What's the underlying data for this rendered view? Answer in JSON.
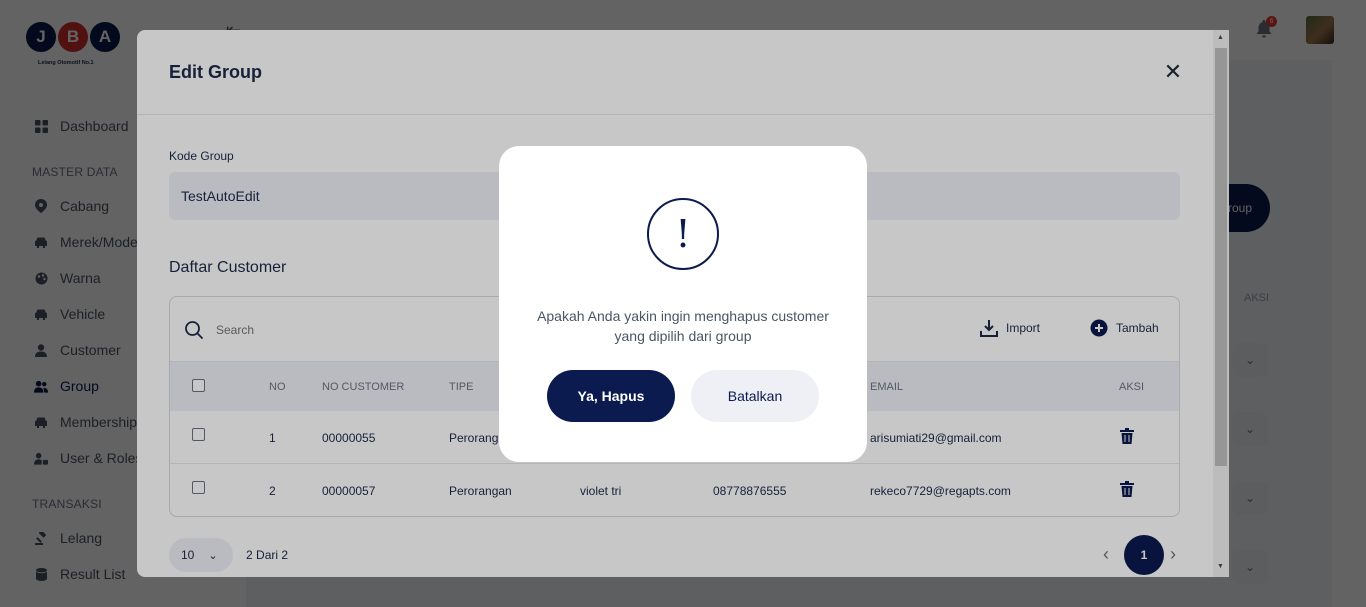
{
  "logo": {
    "letters": [
      "J",
      "B",
      "A"
    ],
    "colors": [
      "#0b1a4f",
      "#d32f2f",
      "#0b1a4f"
    ],
    "tagline": "Lelang Otomotif No.1"
  },
  "sidebar": {
    "items_top": [
      {
        "label": "Dashboard",
        "icon": "grid-icon"
      }
    ],
    "section_master": "MASTER DATA",
    "items_master": [
      {
        "label": "Cabang",
        "icon": "location-pin-icon"
      },
      {
        "label": "Merek/Model",
        "icon": "car-icon"
      },
      {
        "label": "Warna",
        "icon": "palette-icon"
      },
      {
        "label": "Vehicle",
        "icon": "car-icon"
      },
      {
        "label": "Customer",
        "icon": "user-icon"
      },
      {
        "label": "Group",
        "icon": "users-icon"
      },
      {
        "label": "Membership",
        "icon": "car-icon"
      },
      {
        "label": "User & Roles",
        "icon": "user-lock-icon"
      }
    ],
    "section_transaksi": "TRANSAKSI",
    "items_transaksi": [
      {
        "label": "Lelang",
        "icon": "gavel-icon"
      },
      {
        "label": "Result List",
        "icon": "database-icon"
      }
    ],
    "active": "Group"
  },
  "topbar": {
    "notification_count": "6"
  },
  "background": {
    "button_label": "Group",
    "aksi_header": "AKSI"
  },
  "edit_modal": {
    "title": "Edit Group",
    "kode_label": "Kode Group",
    "kode_value": "TestAutoEdit",
    "daftar_title": "Daftar Customer",
    "search_placeholder": "Search",
    "import_label": "Import",
    "tambah_label": "Tambah",
    "columns": [
      "NO",
      "NO CUSTOMER",
      "TIPE",
      "EMAIL",
      "AKSI"
    ],
    "rows": [
      {
        "no": "1",
        "no_customer": "00000055",
        "tipe": "Perorangan",
        "nama": "",
        "telepon": "",
        "email": "arisumiati29@gmail.com"
      },
      {
        "no": "2",
        "no_customer": "00000057",
        "tipe": "Perorangan",
        "nama": "violet tri",
        "telepon": "08778876555",
        "email": "rekeco7729@regapts.com"
      }
    ],
    "page_size": "10",
    "count_current": "2",
    "count_sep": "Dari",
    "count_total": "2",
    "current_page": "1"
  },
  "confirm": {
    "icon": "!",
    "message": "Apakah Anda yakin ingin menghapus customer yang dipilih dari group",
    "confirm_label": "Ya, Hapus",
    "cancel_label": "Batalkan"
  }
}
